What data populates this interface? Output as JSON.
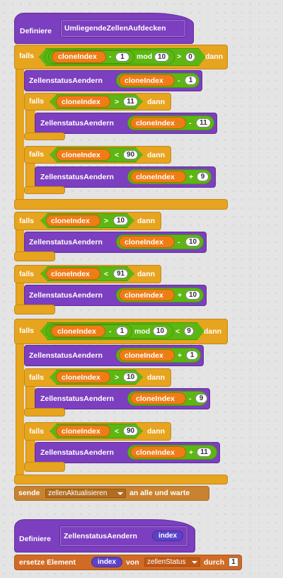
{
  "script1": {
    "define_label": "Definiere",
    "proc_name": "UmliegendeZellenAufdecken",
    "if1": {
      "falls": "falls",
      "var": "cloneIndex",
      "minus": "-",
      "n1": "1",
      "mod": "mod",
      "n2": "10",
      "gt": ">",
      "n3": "0",
      "dann": "dann"
    },
    "call1": {
      "proc": "ZellenstatusAendern",
      "var": "cloneIndex",
      "op": "-",
      "n": "1"
    },
    "if1a": {
      "falls": "falls",
      "var": "cloneIndex",
      "op": ">",
      "n": "11",
      "dann": "dann"
    },
    "call1a": {
      "proc": "ZellenstatusAendern",
      "var": "cloneIndex",
      "op": "-",
      "n": "11"
    },
    "if1b": {
      "falls": "falls",
      "var": "cloneIndex",
      "op": "<",
      "n": "90",
      "dann": "dann"
    },
    "call1b": {
      "proc": "ZellenstatusAendern",
      "var": "cloneIndex",
      "op": "+",
      "n": "9"
    },
    "if2": {
      "falls": "falls",
      "var": "cloneIndex",
      "op": ">",
      "n": "10",
      "dann": "dann"
    },
    "call2": {
      "proc": "ZellenstatusAendern",
      "var": "cloneIndex",
      "op": "-",
      "n": "10"
    },
    "if3": {
      "falls": "falls",
      "var": "cloneIndex",
      "op": "<",
      "n": "91",
      "dann": "dann"
    },
    "call3": {
      "proc": "ZellenstatusAendern",
      "var": "cloneIndex",
      "op": "+",
      "n": "10"
    },
    "if4": {
      "falls": "falls",
      "var": "cloneIndex",
      "minus": "-",
      "n1": "1",
      "mod": "mod",
      "n2": "10",
      "lt": "<",
      "n3": "9",
      "dann": "dann"
    },
    "call4": {
      "proc": "ZellenstatusAendern",
      "var": "cloneIndex",
      "op": "+",
      "n": "1"
    },
    "if4a": {
      "falls": "falls",
      "var": "cloneIndex",
      "op": ">",
      "n": "10",
      "dann": "dann"
    },
    "call4a": {
      "proc": "ZellenstatusAendern",
      "var": "cloneIndex",
      "op": "-",
      "n": "9"
    },
    "if4b": {
      "falls": "falls",
      "var": "cloneIndex",
      "op": "<",
      "n": "90",
      "dann": "dann"
    },
    "call4b": {
      "proc": "ZellenstatusAendern",
      "var": "cloneIndex",
      "op": "+",
      "n": "11"
    },
    "broadcast": {
      "sende": "sende",
      "message": "zellenAktualisieren",
      "rest": "an alle und warte"
    }
  },
  "script2": {
    "define_label": "Definiere",
    "proc_name": "ZellenstatusAendern",
    "param": "index",
    "replace": {
      "label": "ersetze Element",
      "param": "index",
      "von": "von",
      "list": "zellenStatus",
      "durch": "durch",
      "value": "1"
    }
  },
  "colors": {
    "background": "#e4e4e4",
    "more_blocks": "#7c3fbf",
    "control": "#e7a41f",
    "operators": "#5cb712",
    "variables": "#ee7d16",
    "lists": "#d06b25",
    "events": "#c88330"
  }
}
